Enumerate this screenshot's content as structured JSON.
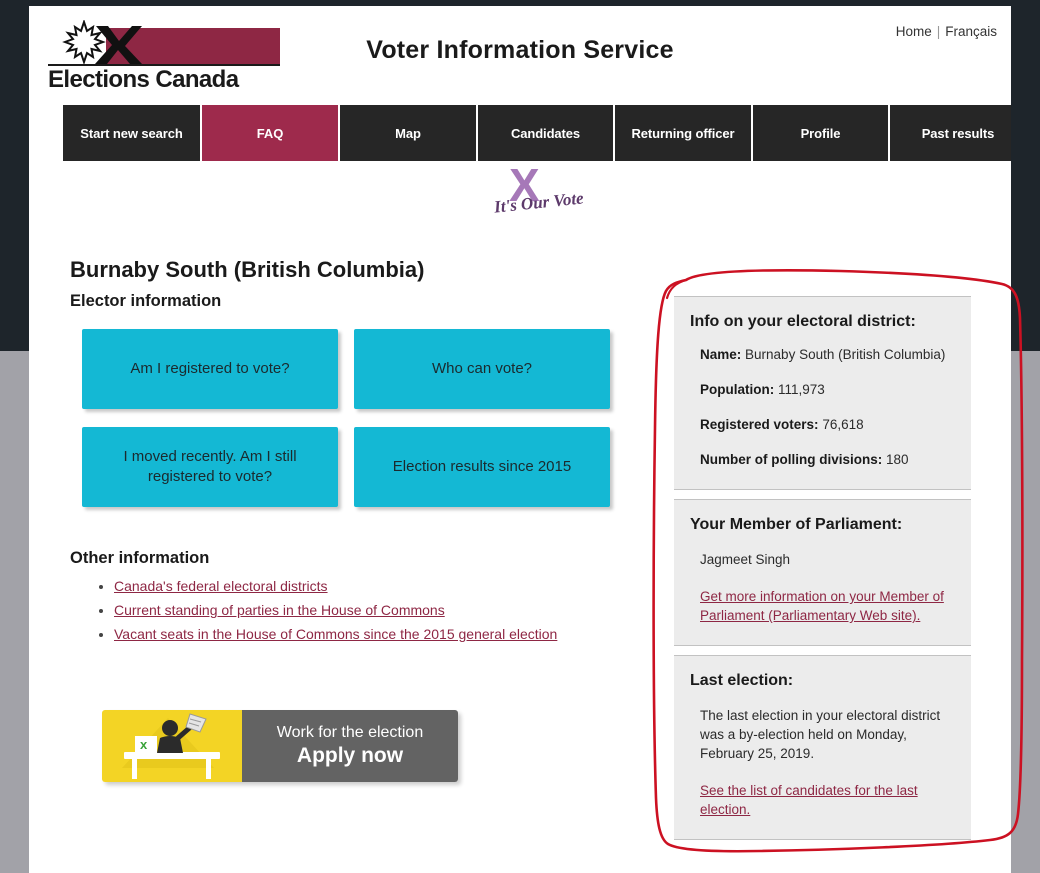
{
  "window": {
    "chrome_top_color": "#1e252b",
    "chrome_bottom_color": "#a2a2a8"
  },
  "header": {
    "site_title": "Voter Information Service",
    "logo_wordmark": "Elections Canada",
    "logo_bar_color": "#8e2744",
    "top_links": [
      {
        "label": "Home"
      },
      {
        "label": "Français"
      }
    ],
    "top_links_divider": "|"
  },
  "nav": {
    "active_color": "#9e2a4c",
    "inactive_color": "#262626",
    "tabs": [
      {
        "label": "Start new search",
        "active": false
      },
      {
        "label": "FAQ",
        "active": true
      },
      {
        "label": "Map",
        "active": false
      },
      {
        "label": "Candidates",
        "active": false
      },
      {
        "label": "Returning officer",
        "active": false
      },
      {
        "label": "Profile",
        "active": false
      },
      {
        "label": "Past results",
        "active": false
      }
    ]
  },
  "badge": {
    "x_glyph": "X",
    "tagline": "It's Our Vote",
    "x_color": "#a678b8",
    "text_color": "#5d3a6b"
  },
  "main": {
    "district_heading": "Burnaby South (British Columbia)",
    "elector_section_title": "Elector information",
    "tile_color": "#14b8d4",
    "tiles": [
      {
        "label": "Am I registered to vote?"
      },
      {
        "label": "Who can vote?"
      },
      {
        "label": "I moved recently. Am I still registered to vote?"
      },
      {
        "label": "Election results since 2015"
      }
    ],
    "other_section_title": "Other information",
    "other_links": [
      {
        "label": "Canada's federal electoral districts"
      },
      {
        "label": "Current standing of parties in the House of Commons"
      },
      {
        "label": "Vacant seats in the House of Commons since the 2015 general election"
      }
    ],
    "link_color": "#8e2744"
  },
  "apply_banner": {
    "line1": "Work for the election",
    "line2": "Apply now",
    "art_bg_color": "#f3d425",
    "text_bg_color": "#636363"
  },
  "sidebar": {
    "district_panel": {
      "heading": "Info on your electoral district:",
      "rows": [
        {
          "key": "Name:",
          "value": "Burnaby South (British Columbia)"
        },
        {
          "key": "Population:",
          "value": "111,973"
        },
        {
          "key": "Registered voters:",
          "value": "76,618"
        },
        {
          "key": "Number of polling divisions:",
          "value": "180"
        }
      ]
    },
    "mp_panel": {
      "heading": "Your Member of Parliament:",
      "name": "Jagmeet Singh",
      "link": "Get more information on your Member of Parliament (Parliamentary Web site)."
    },
    "last_election_panel": {
      "heading": "Last election:",
      "text": "The last election in your electoral district was a by-election held on Monday, February 25, 2019.",
      "link": "See the list of candidates for the last election."
    }
  },
  "annotation": {
    "shape": "hand-drawn-rounded-rectangle",
    "color": "#cc1122"
  }
}
